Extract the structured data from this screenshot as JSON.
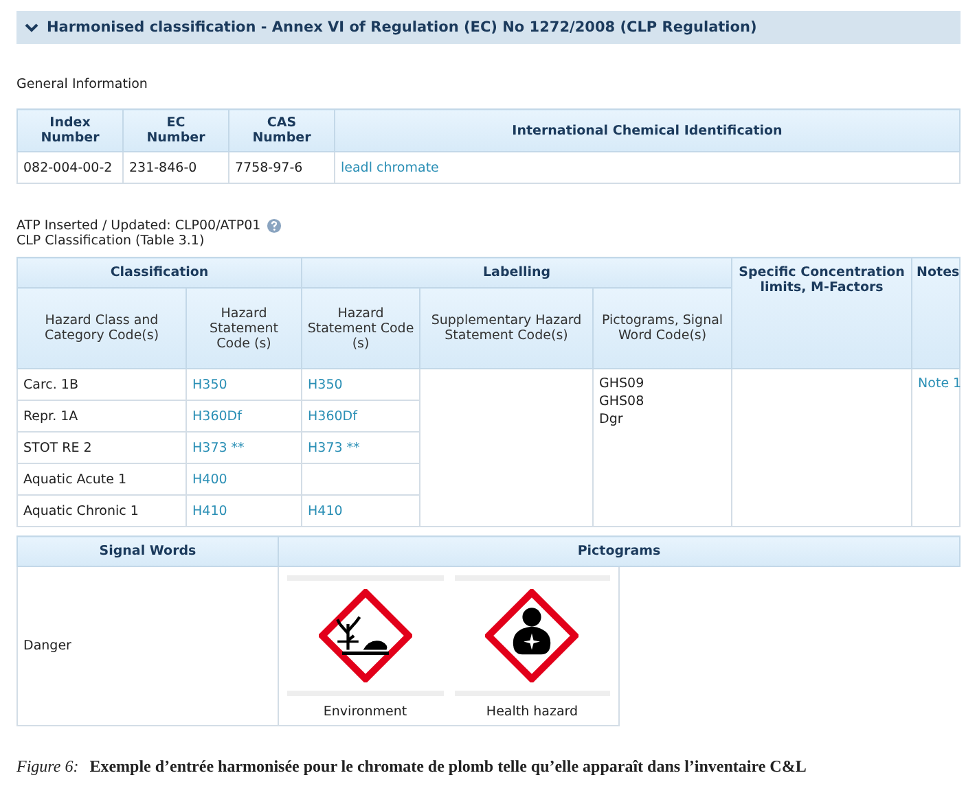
{
  "section": {
    "title": "Harmonised classification - Annex VI of Regulation (EC) No 1272/2008 (CLP Regulation)",
    "expanded": true
  },
  "general_info": {
    "title": "General Information",
    "columns": [
      [
        "Index",
        "Number"
      ],
      [
        "EC",
        "Number"
      ],
      [
        "CAS",
        "Number"
      ],
      [
        "International Chemical Identification"
      ]
    ],
    "rows": [
      {
        "index": "082-004-00-2",
        "ec": "231-846-0",
        "cas": "7758-97-6",
        "name": "leadl chromate"
      }
    ]
  },
  "atp": "ATP Inserted / Updated: CLP00/ATP01",
  "clp_title": "CLP Classification (Table 3.1)",
  "classification": {
    "groups": [
      "Classification",
      "Labelling",
      "Specific Concentration limits, M-Factors",
      "Notes"
    ],
    "columns": [
      "Hazard Class and Category Code(s)",
      "Hazard Statement Code (s)",
      "Hazard Statement Code (s)",
      "Supplementary Hazard Statement Code(s)",
      "Pictograms, Signal Word Code(s)"
    ],
    "rows": [
      {
        "hazard_class": "Carc. 1B",
        "class_code": "H350",
        "label_code": "H350"
      },
      {
        "hazard_class": "Repr. 1A",
        "class_code": "H360Df",
        "label_code": "H360Df"
      },
      {
        "hazard_class": "STOT RE 2",
        "class_code": "H373 **",
        "label_code": "H373 **"
      },
      {
        "hazard_class": "Aquatic Acute 1",
        "class_code": "H400"
      },
      {
        "hazard_class": "Aquatic Chronic 1",
        "class_code": "H410",
        "label_code": "H410"
      }
    ],
    "pictogram_codes": [
      "GHS09",
      "GHS08",
      "Dgr"
    ],
    "note": "Note 1"
  },
  "signal": {
    "columns": [
      "Signal Words",
      "Pictograms"
    ],
    "signal_word": "Danger",
    "pictograms": [
      {
        "kind": "environment",
        "label": "Environment"
      },
      {
        "kind": "health",
        "label": "Health hazard"
      }
    ]
  },
  "caption": {
    "label": "Figure 6:",
    "text": "Exemple d’entrée harmonisée pour le chromate de plomb telle qu’elle apparaît dans l’inventaire C&L"
  }
}
